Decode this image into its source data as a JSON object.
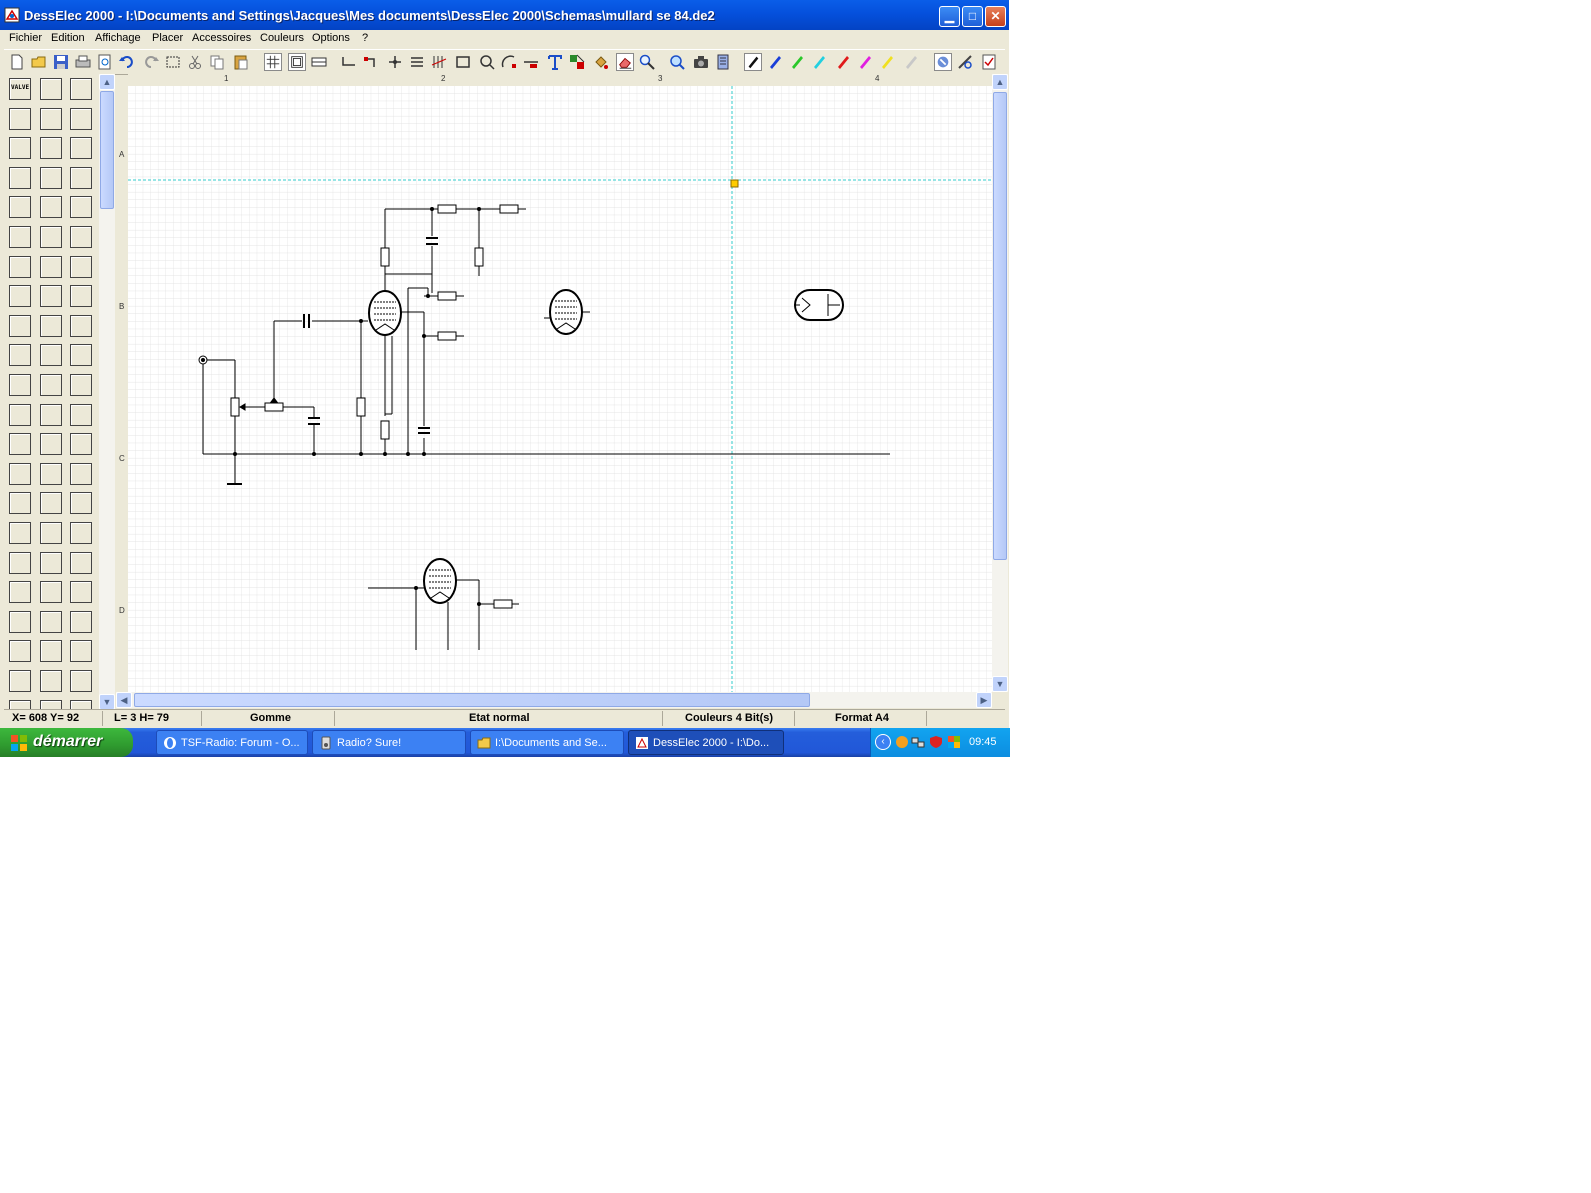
{
  "window": {
    "title": "DessElec 2000 - I:\\Documents and Settings\\Jacques\\Mes documents\\DessElec 2000\\Schemas\\mullard se 84.de2"
  },
  "menu": [
    "Fichier",
    "Edition",
    "Affichage",
    "Placer",
    "Accessoires",
    "Couleurs",
    "Options",
    "?"
  ],
  "ruler": {
    "top": [
      "1",
      "2",
      "3",
      "4"
    ],
    "left": [
      "A",
      "B",
      "C",
      "D"
    ]
  },
  "palette": {
    "first_label": "VALVE"
  },
  "status": {
    "coords": "X= 608  Y= 92",
    "size": "L= 3  H= 79",
    "tool": "Gomme",
    "state": "Etat normal",
    "colors": "Couleurs 4 Bit(s)",
    "format": "Format A4"
  },
  "taskbar": {
    "start": "démarrer",
    "tasks": [
      {
        "label": "TSF-Radio: Forum - O...",
        "icon": "opera-icon"
      },
      {
        "label": "Radio? Sure!",
        "icon": "radio-icon"
      },
      {
        "label": "I:\\Documents and Se...",
        "icon": "folder-icon"
      },
      {
        "label": "DessElec 2000 - I:\\Do...",
        "icon": "desselec-icon"
      }
    ],
    "clock": "09:45"
  },
  "colors": {
    "title_blue": "#0550dc",
    "grid": "#d9d9d9",
    "guide": "#33cccc",
    "marker": "#ffcc00"
  }
}
